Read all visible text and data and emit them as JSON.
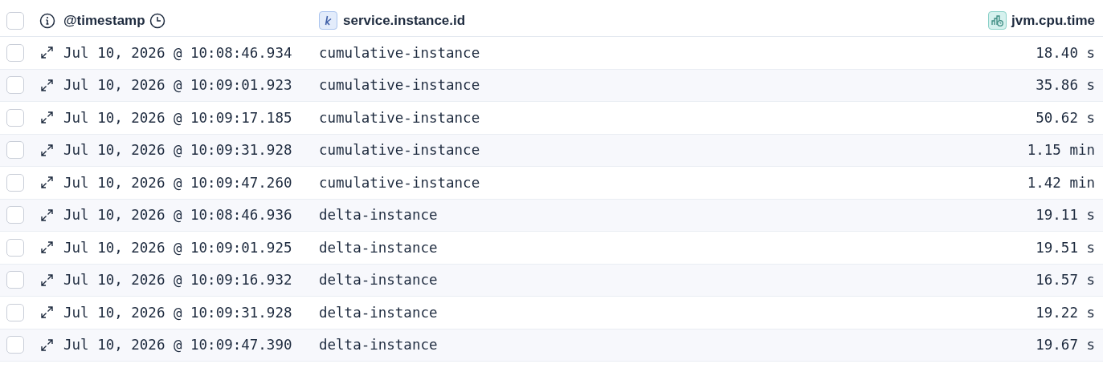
{
  "table": {
    "columns": [
      {
        "label": "@timestamp"
      },
      {
        "label": "service.instance.id"
      },
      {
        "label": "jvm.cpu.time"
      }
    ],
    "header_checkbox": {
      "checked": false
    },
    "rows": [
      {
        "checked": false,
        "timestamp": "Jul 10, 2026 @ 10:08:46.934",
        "instance": "cumulative-instance",
        "cpu_time": "18.40 s"
      },
      {
        "checked": false,
        "timestamp": "Jul 10, 2026 @ 10:09:01.923",
        "instance": "cumulative-instance",
        "cpu_time": "35.86 s"
      },
      {
        "checked": false,
        "timestamp": "Jul 10, 2026 @ 10:09:17.185",
        "instance": "cumulative-instance",
        "cpu_time": "50.62 s"
      },
      {
        "checked": false,
        "timestamp": "Jul 10, 2026 @ 10:09:31.928",
        "instance": "cumulative-instance",
        "cpu_time": "1.15 min"
      },
      {
        "checked": false,
        "timestamp": "Jul 10, 2026 @ 10:09:47.260",
        "instance": "cumulative-instance",
        "cpu_time": "1.42 min"
      },
      {
        "checked": false,
        "timestamp": "Jul 10, 2026 @ 10:08:46.936",
        "instance": "delta-instance",
        "cpu_time": "19.11 s"
      },
      {
        "checked": false,
        "timestamp": "Jul 10, 2026 @ 10:09:01.925",
        "instance": "delta-instance",
        "cpu_time": "19.51 s"
      },
      {
        "checked": false,
        "timestamp": "Jul 10, 2026 @ 10:09:16.932",
        "instance": "delta-instance",
        "cpu_time": "16.57 s"
      },
      {
        "checked": false,
        "timestamp": "Jul 10, 2026 @ 10:09:31.928",
        "instance": "delta-instance",
        "cpu_time": "19.22 s"
      },
      {
        "checked": false,
        "timestamp": "Jul 10, 2026 @ 10:09:47.390",
        "instance": "delta-instance",
        "cpu_time": "19.67 s"
      }
    ]
  }
}
